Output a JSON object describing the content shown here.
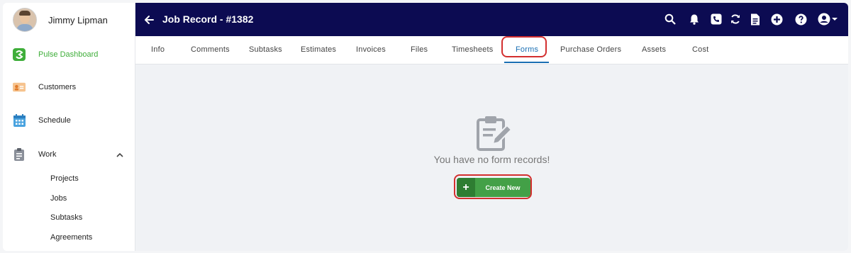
{
  "user": {
    "name": "Jimmy Lipman"
  },
  "sidebar": {
    "items": [
      {
        "label": "Pulse Dashboard",
        "icon": "pulse-logo-icon",
        "active": true
      },
      {
        "label": "Customers",
        "icon": "customer-card-icon"
      },
      {
        "label": "Schedule",
        "icon": "calendar-icon"
      },
      {
        "label": "Work",
        "icon": "clipboard-icon",
        "expanded": true
      }
    ],
    "work_subitems": [
      "Projects",
      "Jobs",
      "Subtasks",
      "Agreements"
    ]
  },
  "header": {
    "title": "Job Record - #1382",
    "icons": [
      "search-icon",
      "bell-icon",
      "phone-icon",
      "sync-icon",
      "document-icon",
      "add-icon",
      "help-icon",
      "account-icon"
    ]
  },
  "tabs": [
    {
      "label": "Info"
    },
    {
      "label": "Comments"
    },
    {
      "label": "Subtasks"
    },
    {
      "label": "Estimates"
    },
    {
      "label": "Invoices"
    },
    {
      "label": "Files"
    },
    {
      "label": "Timesheets"
    },
    {
      "label": "Forms",
      "active": true
    },
    {
      "label": "Purchase Orders"
    },
    {
      "label": "Assets"
    },
    {
      "label": "Cost"
    }
  ],
  "main": {
    "empty_message": "You have no form records!",
    "create_label": "Create New",
    "create_icon": "+"
  },
  "colors": {
    "header_bg": "#0c0b52",
    "active_tab": "#1a6fb3",
    "button_green": "#43a047",
    "highlight_red": "#d32f2f",
    "active_nav": "#3fae3a"
  }
}
